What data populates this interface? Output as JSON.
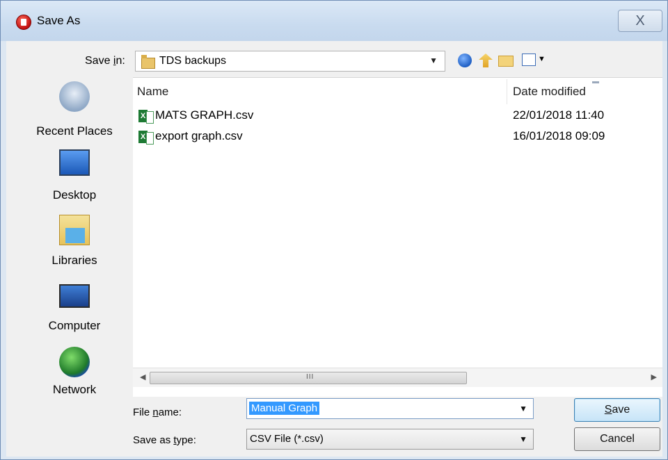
{
  "window": {
    "title": "Save As",
    "close_glyph": "X"
  },
  "toolbar": {
    "save_in_label_pre": "Save ",
    "save_in_label_key": "i",
    "save_in_label_post": "n:",
    "save_in_value": "TDS backups",
    "icons": [
      "back-icon",
      "up-folder-icon",
      "new-folder-icon",
      "view-menu-icon"
    ]
  },
  "places": [
    {
      "label": "Recent Places",
      "icon": "recent-places-icon"
    },
    {
      "label": "Desktop",
      "icon": "desktop-icon"
    },
    {
      "label": "Libraries",
      "icon": "libraries-icon"
    },
    {
      "label": "Computer",
      "icon": "computer-icon"
    },
    {
      "label": "Network",
      "icon": "network-icon"
    }
  ],
  "file_list": {
    "columns": {
      "name": "Name",
      "date": "Date modified"
    },
    "rows": [
      {
        "name": "MATS GRAPH.csv",
        "date": "22/01/2018 11:40"
      },
      {
        "name": "export graph.csv",
        "date": "16/01/2018 09:09"
      }
    ]
  },
  "scrollbar": {
    "grip": "III"
  },
  "form": {
    "file_name_label_pre": "File ",
    "file_name_label_key": "n",
    "file_name_label_post": "ame:",
    "file_name_value": "Manual Graph",
    "type_label_pre": "Save as ",
    "type_label_key": "t",
    "type_label_post": "ype:",
    "type_value": "CSV File (*.csv)"
  },
  "buttons": {
    "save_key": "S",
    "save_rest": "ave",
    "cancel": "Cancel"
  }
}
